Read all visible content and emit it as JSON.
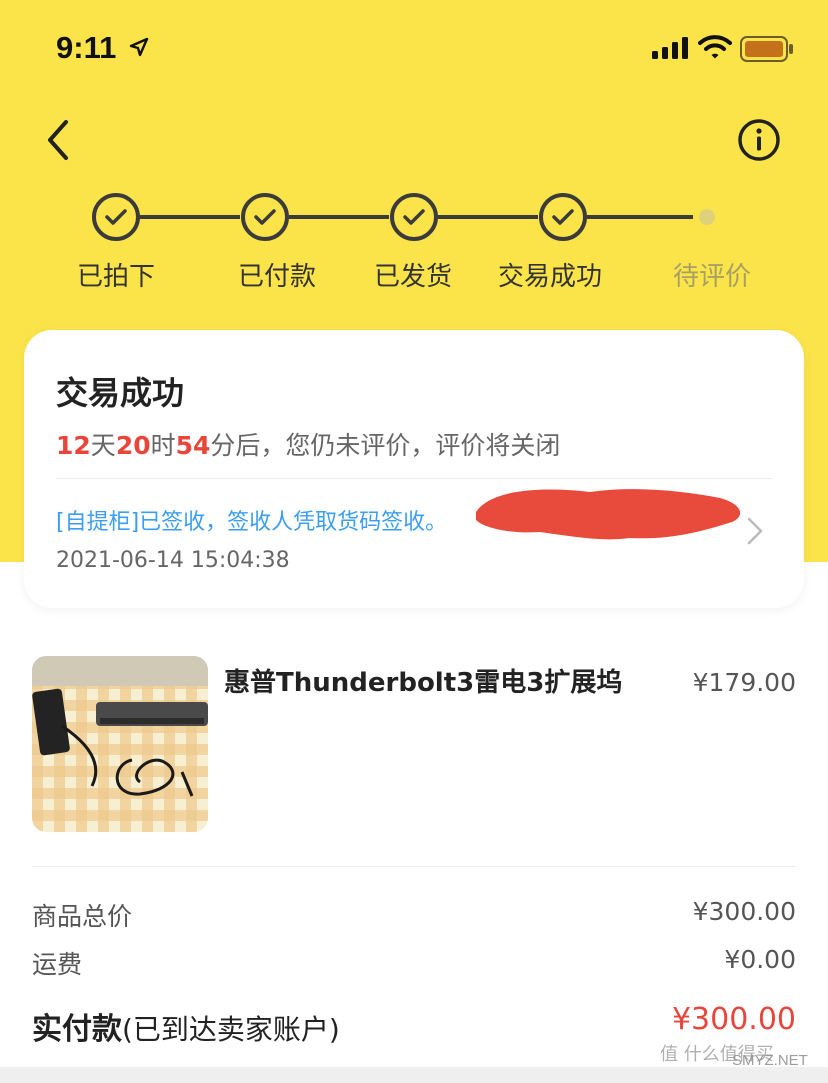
{
  "status_bar": {
    "time": "9:11",
    "location_icon": "location-arrow-icon",
    "signal_icon": "cellular-signal-icon",
    "wifi_icon": "wifi-icon",
    "battery_icon": "battery-icon"
  },
  "nav": {
    "back_icon": "chevron-left-icon",
    "info_icon": "info-circle-icon"
  },
  "progress": {
    "steps": [
      {
        "label": "已拍下",
        "done": true
      },
      {
        "label": "已付款",
        "done": true
      },
      {
        "label": "已发货",
        "done": true
      },
      {
        "label": "交易成功",
        "done": true
      },
      {
        "label": "待评价",
        "done": false
      }
    ]
  },
  "status_card": {
    "title": "交易成功",
    "countdown": {
      "days": "12",
      "days_unit": "天",
      "hours": "20",
      "hours_unit": "时",
      "minutes": "54",
      "minutes_suffix": "分后，您仍未评价，评价将关闭"
    },
    "logistics_text": "[自提柜]已签收，签收人凭取货码签收。",
    "logistics_time": "2021-06-14 15:04:38"
  },
  "product": {
    "name": "惠普Thunderbolt3雷电3扩展坞",
    "price": "¥179.00"
  },
  "summary": {
    "goods_total_label": "商品总价",
    "goods_total_value": "¥300.00",
    "shipping_label": "运费",
    "shipping_value": "¥0.00",
    "paid_label_bold": "实付款",
    "paid_label_note": "(已到达卖家账户)",
    "paid_value": "¥300.00"
  },
  "watermark": {
    "text": "值 什么值得买",
    "sub": "SMYZ.NET"
  },
  "colors": {
    "header_yellow": "#fbe44a",
    "accent_red": "#e8463a",
    "link_blue": "#3b9ef0"
  }
}
